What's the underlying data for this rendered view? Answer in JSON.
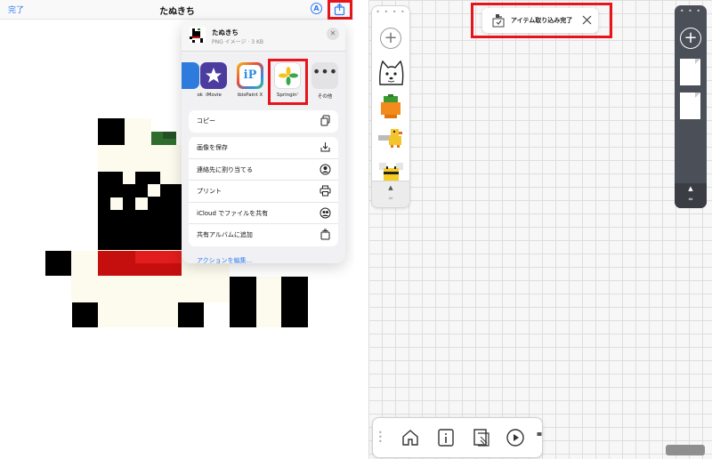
{
  "left": {
    "topbar": {
      "done_label": "完了",
      "title": "たぬきち",
      "markup_icon": "A"
    },
    "share_sheet": {
      "file_name": "たぬきち",
      "file_meta": "PNG イメージ · 3 KB",
      "apps": [
        {
          "label": "ok",
          "icon": "app-icon"
        },
        {
          "label": "iMovie",
          "icon": "imovie-icon"
        },
        {
          "label": "ibisPaint X",
          "icon": "ibispaint-icon"
        },
        {
          "label": "Springin'",
          "icon": "springin-icon"
        },
        {
          "label": "その他",
          "icon": "more-icon"
        }
      ],
      "actions_group1": [
        {
          "label": "コピー",
          "icon": "copy-icon"
        }
      ],
      "actions_group2": [
        {
          "label": "画像を保存",
          "icon": "save-icon"
        },
        {
          "label": "連絡先に割り当てる",
          "icon": "contact-icon"
        },
        {
          "label": "プリント",
          "icon": "print-icon"
        },
        {
          "label": "iCloud でファイルを共有",
          "icon": "icloud-share-icon"
        },
        {
          "label": "共有アルバムに追加",
          "icon": "shared-album-icon"
        }
      ],
      "edit_actions_label": "アクションを編集..."
    }
  },
  "right": {
    "toast": {
      "text": "アイテム取り込み完了"
    },
    "toolbar": {
      "buttons": [
        "home-icon",
        "info-icon",
        "page-icon",
        "play-icon"
      ]
    }
  },
  "colors": {
    "highlight": "#e8141b",
    "link": "#2f7bf5",
    "dark_palette": "#4b4f58"
  }
}
